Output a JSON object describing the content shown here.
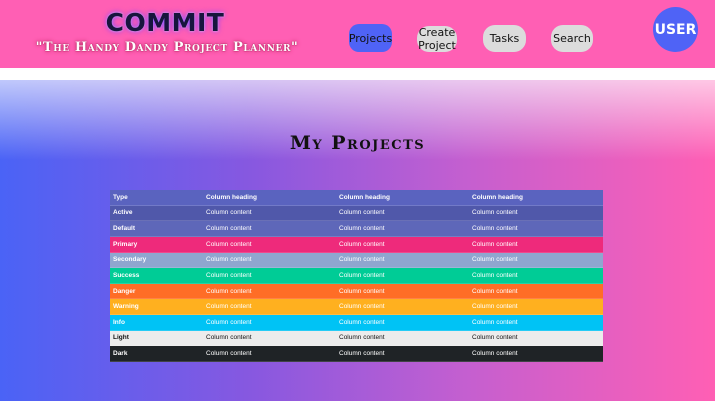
{
  "header": {
    "logo": "COMMIT",
    "tagline": "\"The Handy Dandy Project Planner\"",
    "nav": {
      "projects": "Projects",
      "create_project": "Create Project",
      "tasks": "Tasks",
      "search": "Search"
    },
    "user": "USER"
  },
  "main": {
    "title": "My Projects",
    "table": {
      "headers": [
        "Type",
        "Column heading",
        "Column heading",
        "Column heading"
      ],
      "rows": [
        {
          "type": "Active",
          "cells": [
            "Column content",
            "Column content",
            "Column content"
          ],
          "color": "#5058aa",
          "text": "#ffffff"
        },
        {
          "type": "Default",
          "cells": [
            "Column content",
            "Column content",
            "Column content"
          ],
          "color": "#5e67b9",
          "text": "#ffffff"
        },
        {
          "type": "Primary",
          "cells": [
            "Column content",
            "Column content",
            "Column content"
          ],
          "color": "#ee2a7b",
          "text": "#ffffff"
        },
        {
          "type": "Secondary",
          "cells": [
            "Column content",
            "Column content",
            "Column content"
          ],
          "color": "#8fa6cf",
          "text": "#ffffff"
        },
        {
          "type": "Success",
          "cells": [
            "Column content",
            "Column content",
            "Column content"
          ],
          "color": "#00cc96",
          "text": "#ffffff"
        },
        {
          "type": "Danger",
          "cells": [
            "Column content",
            "Column content",
            "Column content"
          ],
          "color": "#ff6d26",
          "text": "#ffffff"
        },
        {
          "type": "Warning",
          "cells": [
            "Column content",
            "Column content",
            "Column content"
          ],
          "color": "#ffb01f",
          "text": "#ffffff"
        },
        {
          "type": "Info",
          "cells": [
            "Column content",
            "Column content",
            "Column content"
          ],
          "color": "#00c3f5",
          "text": "#ffffff"
        },
        {
          "type": "Light",
          "cells": [
            "Column content",
            "Column content",
            "Column content"
          ],
          "color": "#ececec",
          "text": "#111111"
        },
        {
          "type": "Dark",
          "cells": [
            "Column content",
            "Column content",
            "Column content"
          ],
          "color": "#1f2326",
          "text": "#ffffff"
        }
      ],
      "header_color": "#5a63bf"
    }
  }
}
